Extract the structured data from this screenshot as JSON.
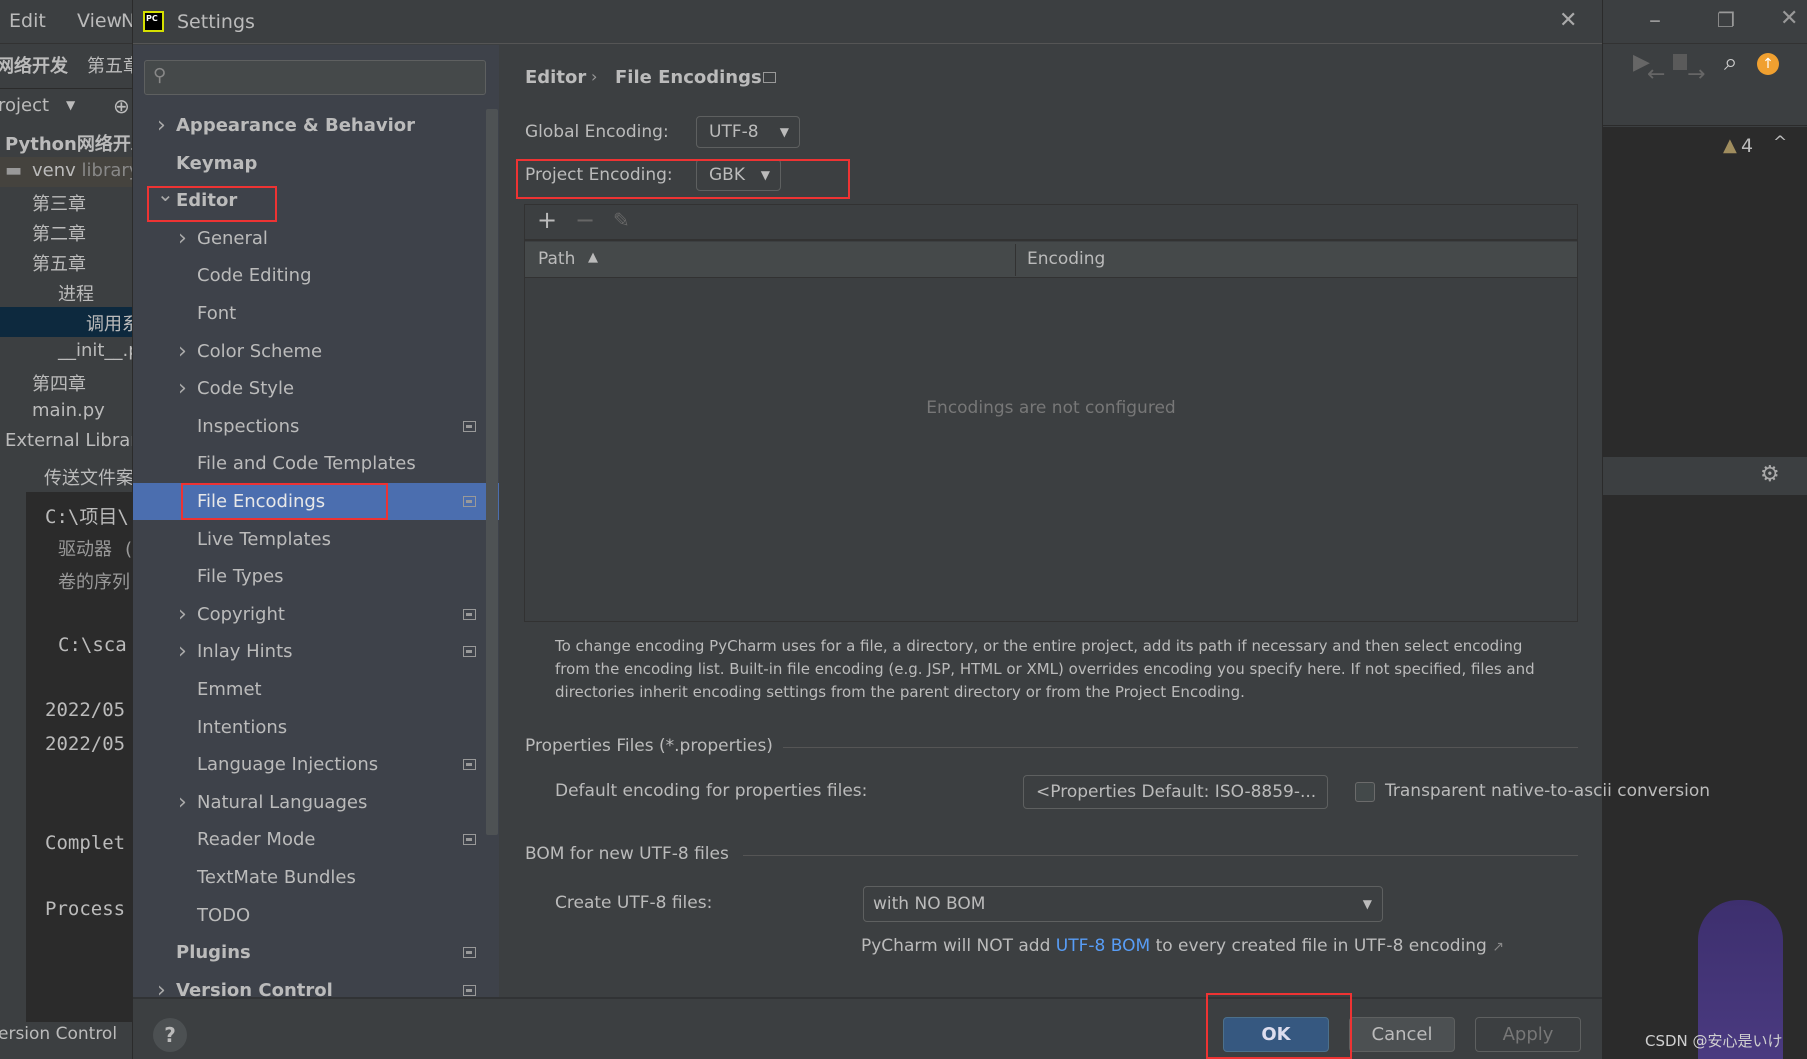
{
  "ide": {
    "menu": [
      "Edit",
      "View",
      "N"
    ],
    "breadcrumb": [
      "网络开发",
      "第五章"
    ],
    "project_selector": "roject",
    "project_root": "Python网络开发",
    "tree": [
      {
        "label": "venv",
        "extra": "library"
      },
      {
        "label": "第三章"
      },
      {
        "label": "第二章"
      },
      {
        "label": "第五章"
      },
      {
        "label": "进程"
      },
      {
        "label": "调用系"
      },
      {
        "label": "__init__.p"
      },
      {
        "label": "第四章"
      },
      {
        "label": "main.py"
      },
      {
        "label": "External Librar"
      }
    ],
    "run_tab": "传送文件案",
    "console": [
      "C:\\项目\\",
      "驱动器 (",
      "卷的序列",
      "C:\\sca",
      "2022/05",
      "2022/05",
      "Complet",
      "Process"
    ],
    "bottom_tab": "ersion Control",
    "warning_count": "4",
    "watermark": "CSDN @安心是いけ"
  },
  "dialog": {
    "title": "Settings",
    "search_placeholder": "",
    "tree": [
      {
        "label": "Appearance & Behavior",
        "level": 0,
        "bold": true,
        "chevron": "right"
      },
      {
        "label": "Keymap",
        "level": 0,
        "bold": true
      },
      {
        "label": "Editor",
        "level": 0,
        "bold": true,
        "chevron": "down"
      },
      {
        "label": "General",
        "level": 1,
        "chevron": "right"
      },
      {
        "label": "Code Editing",
        "level": 1
      },
      {
        "label": "Font",
        "level": 1
      },
      {
        "label": "Color Scheme",
        "level": 1,
        "chevron": "right"
      },
      {
        "label": "Code Style",
        "level": 1,
        "chevron": "right"
      },
      {
        "label": "Inspections",
        "level": 1,
        "project_icon": true
      },
      {
        "label": "File and Code Templates",
        "level": 1
      },
      {
        "label": "File Encodings",
        "level": 1,
        "project_icon": true,
        "selected": true
      },
      {
        "label": "Live Templates",
        "level": 1
      },
      {
        "label": "File Types",
        "level": 1
      },
      {
        "label": "Copyright",
        "level": 1,
        "chevron": "right",
        "project_icon": true
      },
      {
        "label": "Inlay Hints",
        "level": 1,
        "chevron": "right",
        "project_icon": true
      },
      {
        "label": "Emmet",
        "level": 1
      },
      {
        "label": "Intentions",
        "level": 1
      },
      {
        "label": "Language Injections",
        "level": 1,
        "project_icon": true
      },
      {
        "label": "Natural Languages",
        "level": 1,
        "chevron": "right"
      },
      {
        "label": "Reader Mode",
        "level": 1,
        "project_icon": true
      },
      {
        "label": "TextMate Bundles",
        "level": 1
      },
      {
        "label": "TODO",
        "level": 1
      },
      {
        "label": "Plugins",
        "level": 0,
        "bold": true,
        "project_icon": true
      },
      {
        "label": "Version Control",
        "level": 0,
        "bold": true,
        "chevron": "right",
        "project_icon": true
      }
    ],
    "breadcrumb": {
      "parent": "Editor",
      "current": "File Encodings"
    },
    "global_encoding": {
      "label": "Global Encoding:",
      "value": "UTF-8"
    },
    "project_encoding": {
      "label": "Project Encoding:",
      "value": "GBK"
    },
    "table": {
      "columns": [
        "Path",
        "Encoding"
      ],
      "sort": "ascending",
      "empty_text": "Encodings are not configured"
    },
    "help_text": [
      "To change encoding PyCharm uses for a file, a directory, or the entire project, add its path if necessary and then select encoding",
      "from the encoding list. Built-in file encoding (e.g. JSP, HTML or XML) overrides encoding you specify here. If not specified, files and",
      "directories inherit encoding settings from the parent directory or from the Project Encoding."
    ],
    "properties": {
      "heading": "Properties Files (*.properties)",
      "label": "Default encoding for properties files:",
      "value": "<Properties Default: ISO-8859-...",
      "checkbox_label": "Transparent native-to-ascii conversion",
      "checked": false
    },
    "bom": {
      "heading": "BOM for new UTF-8 files",
      "label": "Create UTF-8 files:",
      "value": "with NO BOM",
      "note_before": "PyCharm will NOT add ",
      "note_link": "UTF-8 BOM",
      "note_after": " to every created file in UTF-8 encoding"
    },
    "buttons": {
      "ok": "OK",
      "cancel": "Cancel",
      "apply": "Apply",
      "help": "?"
    },
    "colors": {
      "selection": "#4b6eaf",
      "link": "#589df6",
      "highlight": "#ee3333",
      "ok": "#365880"
    }
  }
}
